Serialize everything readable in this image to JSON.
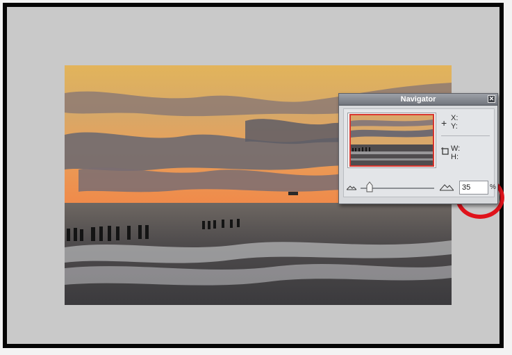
{
  "navigator": {
    "title": "Navigator",
    "close_glyph": "✕",
    "x_label": "X:",
    "y_label": "Y:",
    "w_label": "W:",
    "h_label": "H:",
    "zoom_value": "35",
    "zoom_unit": "%",
    "zoom_slider_level": 0.12
  },
  "icons": {
    "crosshair": "crosshair-icon",
    "selection_size": "selection-size-icon",
    "zoom_out": "zoom-out-mountain-icon",
    "zoom_in": "zoom-in-mountain-icon",
    "close": "close-icon"
  },
  "colors": {
    "view_rectangle": "#d8372f",
    "highlight_ring": "#e0131b",
    "canvas_background": "#c9c9c9",
    "frame": "#050505"
  }
}
